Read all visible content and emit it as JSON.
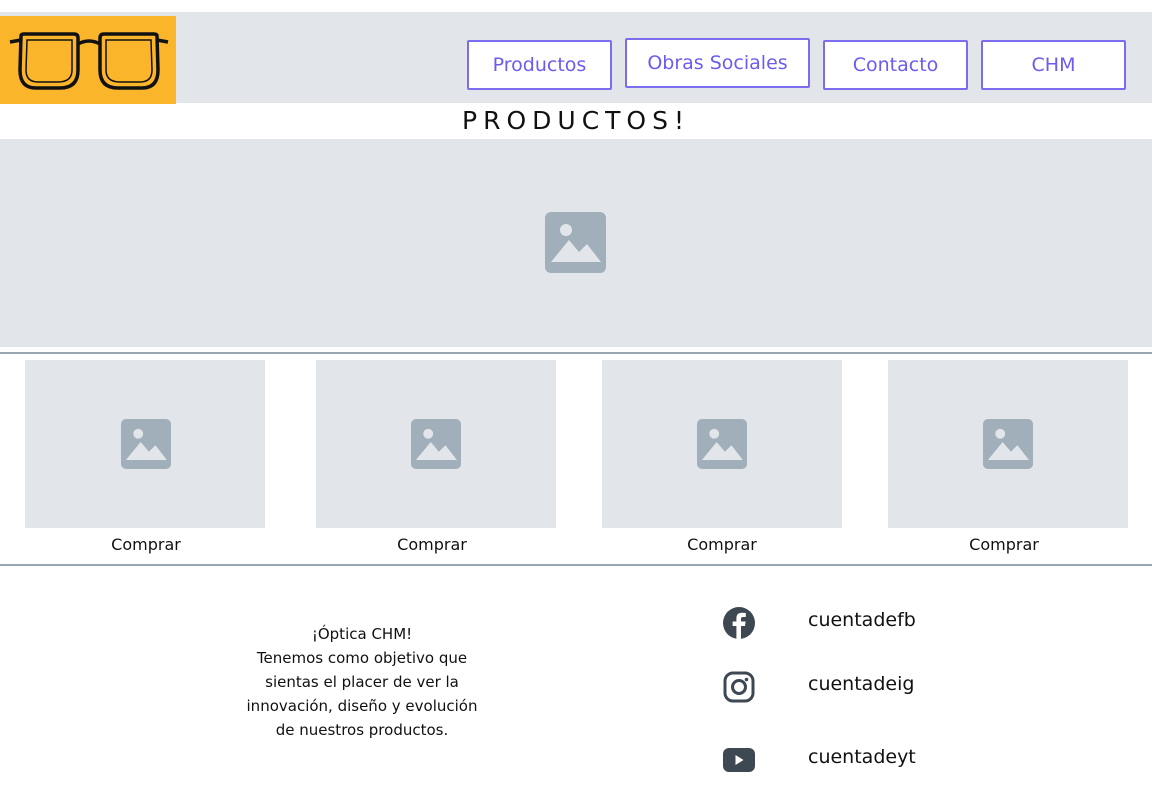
{
  "nav": {
    "productos": "Productos",
    "obras_sociales": "Obras Sociales",
    "contacto": "Contacto",
    "chm": "CHM"
  },
  "page": {
    "title": "PRODUCTOS!"
  },
  "products": [
    {
      "buy_label": "Comprar"
    },
    {
      "buy_label": "Comprar"
    },
    {
      "buy_label": "Comprar"
    },
    {
      "buy_label": "Comprar"
    }
  ],
  "footer": {
    "line1": "¡Óptica CHM!",
    "line2": "Tenemos como objetivo que",
    "line3": "sientas el placer de ver la",
    "line4": "innovación, diseño y evolución",
    "line5": "de nuestros productos."
  },
  "social": {
    "facebook": "cuentadefb",
    "instagram": "cuentadeig",
    "youtube": "cuentadeyt"
  },
  "colors": {
    "logo_bg": "#fbb52b",
    "header_bg": "#e2e6ea",
    "nav_accent": "#6b5cf0",
    "placeholder_bg": "#e2e6ea",
    "placeholder_icon": "#a1afbb",
    "social_icon": "#3d4852"
  },
  "icons": [
    "glasses-logo-icon",
    "image-placeholder-icon",
    "facebook-icon",
    "instagram-icon",
    "youtube-icon"
  ]
}
